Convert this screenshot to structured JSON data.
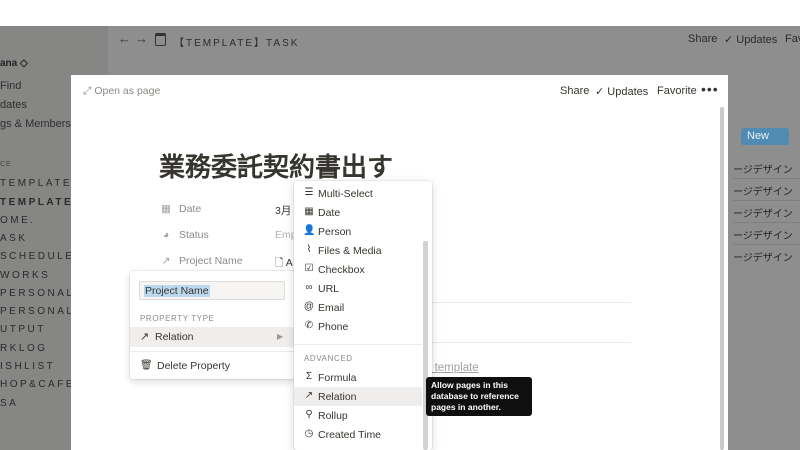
{
  "sidebar": {
    "workspace": "ana ◇",
    "items": [
      "Find",
      "dates",
      "gs & Members"
    ],
    "section": "CE",
    "pages": [
      "TEMPLATE]",
      "TEMPLATE]",
      "OME.",
      "ASK",
      "SCHEDULE",
      "WORKS",
      "PERSONALW",
      "PERSONALP",
      "UTPUT",
      "RKLOG",
      "ISHLIST",
      "HOP&CAFE",
      "SA"
    ]
  },
  "topbar": {
    "title": "【TEMPLATE】TASK",
    "share": "Share",
    "updates": "Updates",
    "favorite": "Fav"
  },
  "background": {
    "new_label": "New",
    "rows": [
      "ージデザイン",
      "ージデザイン",
      "ージデザイン",
      "ージデザイン",
      "ージデザイン"
    ]
  },
  "modal": {
    "open_as_page": "Open as page",
    "share": "Share",
    "updates": "Updates",
    "favorite": "Favorite",
    "more": "•••",
    "title": "業務委託契約書出す",
    "properties": [
      {
        "name": "Date",
        "value": "3月"
      },
      {
        "name": "Status",
        "value": "Emp"
      },
      {
        "name": "Project Name",
        "value": "A"
      }
    ],
    "template_link": "a template"
  },
  "property_menu": {
    "input_value": "Project Name",
    "section_label": "PROPERTY TYPE",
    "type_selected": "Relation",
    "delete_label": "Delete Property"
  },
  "type_menu": {
    "basic": [
      {
        "label": "Multi-Select",
        "icon": "list-icon"
      },
      {
        "label": "Date",
        "icon": "calendar-icon"
      },
      {
        "label": "Person",
        "icon": "person-icon"
      },
      {
        "label": "Files & Media",
        "icon": "paperclip-icon"
      },
      {
        "label": "Checkbox",
        "icon": "checkbox-icon"
      },
      {
        "label": "URL",
        "icon": "link-icon"
      },
      {
        "label": "Email",
        "icon": "at-icon"
      },
      {
        "label": "Phone",
        "icon": "phone-icon"
      }
    ],
    "advanced_label": "ADVANCED",
    "advanced": [
      {
        "label": "Formula",
        "icon": "sigma-icon"
      },
      {
        "label": "Relation",
        "icon": "arrow-up-right-icon"
      },
      {
        "label": "Rollup",
        "icon": "search-icon"
      },
      {
        "label": "Created Time",
        "icon": "clock-icon"
      }
    ]
  },
  "tooltip": {
    "text": "Allow pages in this database to reference pages in another."
  },
  "colors": {
    "overlay": "#8e8e8e",
    "accent": "#4f8bb3",
    "highlight": "#efeeec",
    "selection": "#bcd8ef"
  }
}
